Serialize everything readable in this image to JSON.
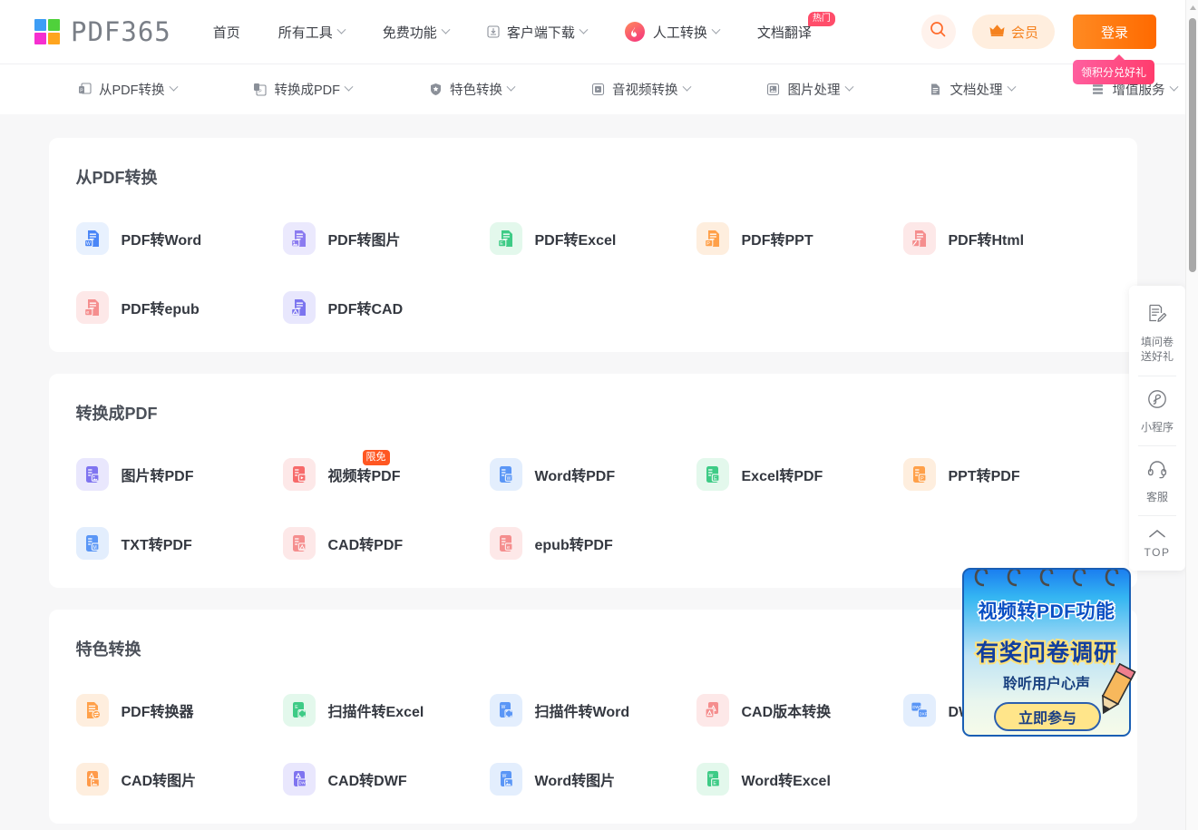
{
  "brand": {
    "name": "PDF365",
    "logo_colors": [
      "#3d9df5",
      "#4fd13b",
      "#f62fd0",
      "#ffa51f"
    ]
  },
  "header": {
    "nav": [
      {
        "label": "首页",
        "icon": "",
        "caret": false,
        "badge": ""
      },
      {
        "label": "所有工具",
        "icon": "",
        "caret": true,
        "badge": ""
      },
      {
        "label": "免费功能",
        "icon": "",
        "caret": true,
        "badge": ""
      },
      {
        "label": "客户端下载",
        "icon": "download-icon",
        "caret": true,
        "badge": ""
      },
      {
        "label": "人工转换",
        "icon": "fire-icon",
        "caret": true,
        "badge": ""
      },
      {
        "label": "文档翻译",
        "icon": "",
        "caret": false,
        "badge": "热门"
      }
    ],
    "search_icon": "search-icon",
    "vip_label": "会员",
    "vip_icon": "crown-icon",
    "login_label": "登录",
    "tooltip": "领积分兑好礼",
    "accent_color": "#ff6a00"
  },
  "subnav": {
    "items": [
      {
        "label": "从PDF转换",
        "icon": "pdf-out-icon"
      },
      {
        "label": "转换成PDF",
        "icon": "pdf-in-icon"
      },
      {
        "label": "特色转换",
        "icon": "shield-star-icon"
      },
      {
        "label": "音视频转换",
        "icon": "media-icon"
      },
      {
        "label": "图片处理",
        "icon": "image-icon"
      },
      {
        "label": "文档处理",
        "icon": "document-icon"
      },
      {
        "label": "增值服务",
        "icon": "layers-icon"
      }
    ]
  },
  "sections": [
    {
      "title": "从PDF转换",
      "tools": [
        {
          "label": "PDF转Word",
          "icon": "doc-w-icon",
          "bg": "#e8f1fe",
          "fg": "#4a86f7",
          "tag": "W",
          "badge": ""
        },
        {
          "label": "PDF转图片",
          "icon": "doc-img-icon",
          "bg": "#ebe9fd",
          "fg": "#8b7bf0",
          "tag": "IMG",
          "badge": ""
        },
        {
          "label": "PDF转Excel",
          "icon": "doc-e-icon",
          "bg": "#e3f8ec",
          "fg": "#3ecb86",
          "tag": "E",
          "badge": ""
        },
        {
          "label": "PDF转PPT",
          "icon": "doc-p-icon",
          "bg": "#feeede",
          "fg": "#ffa049",
          "tag": "P",
          "badge": ""
        },
        {
          "label": "PDF转Html",
          "icon": "doc-html-icon",
          "bg": "#fde8e8",
          "fg": "#f58e8e",
          "tag": "H",
          "badge": ""
        },
        {
          "label": "PDF转epub",
          "icon": "doc-epub-icon",
          "bg": "#fde8e8",
          "fg": "#f58e8e",
          "tag": "E",
          "badge": ""
        },
        {
          "label": "PDF转CAD",
          "icon": "doc-cad-icon",
          "bg": "#e8e7fd",
          "fg": "#7b74ef",
          "tag": "A",
          "badge": ""
        }
      ]
    },
    {
      "title": "转换成PDF",
      "tools": [
        {
          "label": "图片转PDF",
          "icon": "img-to-pdf-icon",
          "bg": "#e9e7fd",
          "fg": "#7f74f0",
          "tag": "IMG",
          "badge": ""
        },
        {
          "label": "视频转PDF",
          "icon": "video-to-pdf-icon",
          "bg": "#fde8e8",
          "fg": "#f76a6a",
          "tag": "PLY",
          "badge": "限免"
        },
        {
          "label": "Word转PDF",
          "icon": "word-to-pdf-icon",
          "bg": "#e3eefd",
          "fg": "#5a96f6",
          "tag": "W",
          "badge": ""
        },
        {
          "label": "Excel转PDF",
          "icon": "excel-to-pdf-icon",
          "bg": "#e3f8ec",
          "fg": "#3ecb86",
          "tag": "E",
          "badge": ""
        },
        {
          "label": "PPT转PDF",
          "icon": "ppt-to-pdf-icon",
          "bg": "#feeede",
          "fg": "#ffa049",
          "tag": "P",
          "badge": ""
        },
        {
          "label": "TXT转PDF",
          "icon": "txt-to-pdf-icon",
          "bg": "#e3eefd",
          "fg": "#5a96f6",
          "tag": "M",
          "badge": ""
        },
        {
          "label": "CAD转PDF",
          "icon": "cad-to-pdf-icon",
          "bg": "#fde8e8",
          "fg": "#f58e8e",
          "tag": "A",
          "badge": ""
        },
        {
          "label": "epub转PDF",
          "icon": "epub-to-pdf-icon",
          "bg": "#fde8e8",
          "fg": "#f58e8e",
          "tag": "E",
          "badge": ""
        }
      ]
    },
    {
      "title": "特色转换",
      "tools": [
        {
          "label": "PDF转换器",
          "icon": "converter-icon",
          "bg": "#feeede",
          "fg": "#ffa049",
          "tag": "C",
          "badge": ""
        },
        {
          "label": "扫描件转Excel",
          "icon": "scan-excel-icon",
          "bg": "#e3f8ec",
          "fg": "#3ecb86",
          "tag": "E",
          "badge": ""
        },
        {
          "label": "扫描件转Word",
          "icon": "scan-word-icon",
          "bg": "#e3eefd",
          "fg": "#5a96f6",
          "tag": "W",
          "badge": ""
        },
        {
          "label": "CAD版本转换",
          "icon": "cad-version-icon",
          "bg": "#fde8e8",
          "fg": "#f58e8e",
          "tag": "A",
          "badge": ""
        },
        {
          "label": "DWG DXF互转",
          "icon": "dwg-dxf-icon",
          "bg": "#e3eefd",
          "fg": "#5a96f6",
          "tag": "DWG",
          "badge": ""
        },
        {
          "label": "CAD转图片",
          "icon": "cad-img-icon",
          "bg": "#feeede",
          "fg": "#ff9a49",
          "tag": "A",
          "badge": ""
        },
        {
          "label": "CAD转DWF",
          "icon": "cad-dwf-icon",
          "bg": "#e9e7fd",
          "fg": "#7f74f0",
          "tag": "DWF",
          "badge": ""
        },
        {
          "label": "Word转图片",
          "icon": "word-img-icon",
          "bg": "#e3eefd",
          "fg": "#5a96f6",
          "tag": "W",
          "badge": ""
        },
        {
          "label": "Word转Excel",
          "icon": "word-excel-icon",
          "bg": "#e3f8ec",
          "fg": "#3ecb86",
          "tag": "W",
          "badge": ""
        }
      ]
    }
  ],
  "rail": {
    "items": [
      {
        "label_1": "填问卷",
        "label_2": "送好礼",
        "icon": "survey-icon"
      },
      {
        "label_1": "小程序",
        "label_2": "",
        "icon": "miniprogram-icon"
      },
      {
        "label_1": "客服",
        "label_2": "",
        "icon": "headset-icon"
      },
      {
        "label_1": "TOP",
        "label_2": "",
        "icon": "arrow-up-icon"
      }
    ]
  },
  "promo": {
    "line1": "视频转PDF功能",
    "line2": "有奖问卷调研",
    "line3": "聆听用户心声",
    "button": "立即参与"
  }
}
